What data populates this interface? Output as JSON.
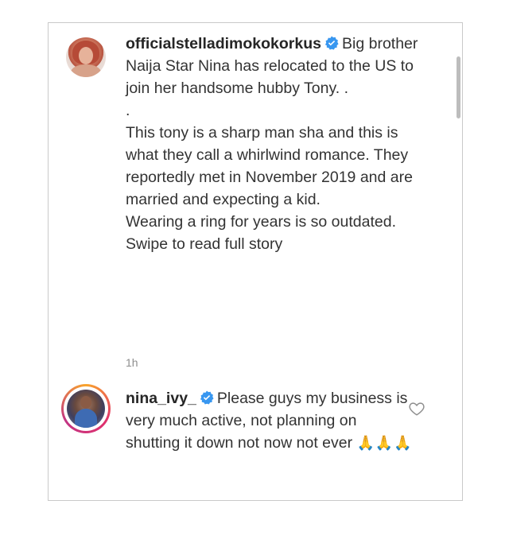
{
  "caption": {
    "username": "officialstelladimokokorkus",
    "lines": [
      "Big brother Naija Star Nina has relocated to the US to join her handsome hubby Tony. .",
      ".",
      "This tony is a sharp man sha and this is what they call a whirlwind romance. They reportedly met in November 2019 and are married and expecting a kid.",
      "Wearing a ring for years is so outdated.",
      "Swipe to read full story"
    ],
    "timestamp": "1h"
  },
  "reply": {
    "username": "nina_ivy_",
    "text": "Please guys my business is very much active, not planning on shutting it down not now not ever",
    "emojis": "🙏🙏🙏"
  },
  "colors": {
    "verified_badge": "#3897f0",
    "text": "#262626",
    "muted": "#8e8e8e"
  },
  "icons": {
    "verified": "verified-badge-icon",
    "like": "heart-outline-icon"
  }
}
